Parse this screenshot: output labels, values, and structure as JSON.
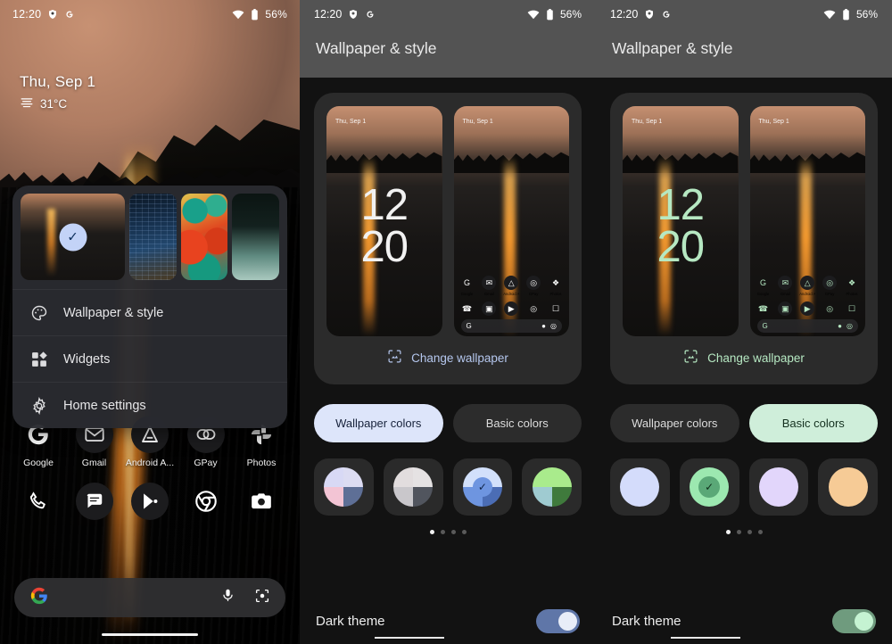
{
  "home": {
    "status_bar": {
      "time": "12:20",
      "icons_left": [
        "shield-icon",
        "google-g-icon"
      ],
      "icons_right": [
        "wifi-icon",
        "battery-icon"
      ],
      "battery": "56%"
    },
    "clock_widget": {
      "date": "Thu, Sep 1",
      "temperature": "31°C",
      "weather_icon": "haze-icon"
    },
    "popup_menu": {
      "wallpaper_thumbnails": [
        {
          "name": "yosemite-firefall-wallpaper",
          "selected": true
        },
        {
          "name": "city-night-wallpaper",
          "selected": false
        },
        {
          "name": "abstract-art-wallpaper",
          "selected": false
        },
        {
          "name": "gradient-wallpaper",
          "selected": false
        }
      ],
      "items": [
        {
          "label": "Wallpaper & style",
          "icon": "palette-icon"
        },
        {
          "label": "Widgets",
          "icon": "widgets-icon"
        },
        {
          "label": "Home settings",
          "icon": "gear-icon"
        }
      ]
    },
    "apps_row1": [
      {
        "label": "Google",
        "icon": "google-g-icon"
      },
      {
        "label": "Gmail",
        "icon": "gmail-icon"
      },
      {
        "label": "Android A...",
        "icon": "android-auto-icon"
      },
      {
        "label": "GPay",
        "icon": "gpay-icon"
      },
      {
        "label": "Photos",
        "icon": "photos-icon"
      }
    ],
    "apps_row2": [
      {
        "label": "",
        "icon": "phone-icon"
      },
      {
        "label": "",
        "icon": "messages-icon"
      },
      {
        "label": "",
        "icon": "play-store-icon"
      },
      {
        "label": "",
        "icon": "chrome-icon"
      },
      {
        "label": "",
        "icon": "camera-icon"
      }
    ],
    "search_bar": {
      "leading_icon": "google-g-icon",
      "mic_icon": "mic-icon",
      "lens_icon": "lens-icon"
    },
    "nav_pill": "home-gesture-pill"
  },
  "settings_middle": {
    "status_bar": {
      "time": "12:20",
      "battery": "56%"
    },
    "title": "Wallpaper & style",
    "preview": {
      "lock_screen": {
        "date": "Thu, Sep 1",
        "clock_hour": "12",
        "clock_minute": "20"
      },
      "home_screen": {
        "date": "Thu, Sep 1",
        "apps_row1": [
          {
            "label": "Google",
            "icon": "google-g-icon"
          },
          {
            "label": "Gmail",
            "icon": "gmail-icon"
          },
          {
            "label": "Android A...",
            "icon": "android-auto-icon"
          },
          {
            "label": "GPay",
            "icon": "gpay-icon"
          },
          {
            "label": "Photos",
            "icon": "photos-icon"
          }
        ],
        "apps_row2": [
          {
            "icon": "phone-icon"
          },
          {
            "icon": "messages-icon"
          },
          {
            "icon": "play-store-icon"
          },
          {
            "icon": "chrome-icon"
          },
          {
            "icon": "camera-icon"
          }
        ]
      }
    },
    "change_wallpaper": {
      "label": "Change wallpaper",
      "icon": "image-frame-icon"
    },
    "tabs": [
      {
        "label": "Wallpaper colors",
        "selected": true
      },
      {
        "label": "Basic colors",
        "selected": false
      }
    ],
    "swatches": [
      {
        "name": "swatch-pink-blue",
        "selected": false,
        "colors": [
          "#d8d9f5",
          "#dcdcf2",
          "#f3c4d4",
          "#5e6f96"
        ]
      },
      {
        "name": "swatch-neutral-gray",
        "selected": false,
        "colors": [
          "#e2ddde",
          "#e5e2e3",
          "#c9c7cb",
          "#51555e"
        ]
      },
      {
        "name": "swatch-blue",
        "selected": true,
        "colors": [
          "#d2e0fb",
          "#d2e0fb",
          "#6e95e0",
          "#4b6db5"
        ]
      },
      {
        "name": "swatch-green",
        "selected": false,
        "colors": [
          "#a9eb8c",
          "#a9eb8c",
          "#9fcbd1",
          "#3f7a3c"
        ]
      }
    ],
    "page_dots": {
      "count": 4,
      "active": 0
    },
    "dark_theme": {
      "label": "Dark theme",
      "enabled": true
    },
    "accent_color": "#b5c7ee"
  },
  "settings_right": {
    "status_bar": {
      "time": "12:20",
      "battery": "56%"
    },
    "title": "Wallpaper & style",
    "preview": {
      "lock_screen": {
        "date": "Thu, Sep 1",
        "clock_hour": "12",
        "clock_minute": "20"
      },
      "home_screen": {
        "date": "Thu, Sep 1",
        "apps_row1": [
          {
            "label": "Google",
            "icon": "google-g-icon"
          },
          {
            "label": "Gmail",
            "icon": "gmail-icon"
          },
          {
            "label": "Android A...",
            "icon": "android-auto-icon"
          },
          {
            "label": "GPay",
            "icon": "gpay-icon"
          },
          {
            "label": "Photos",
            "icon": "photos-icon"
          }
        ],
        "apps_row2": [
          {
            "icon": "phone-icon"
          },
          {
            "icon": "messages-icon"
          },
          {
            "icon": "play-store-icon"
          },
          {
            "icon": "chrome-icon"
          },
          {
            "icon": "camera-icon"
          }
        ]
      }
    },
    "change_wallpaper": {
      "label": "Change wallpaper",
      "icon": "image-frame-icon"
    },
    "tabs": [
      {
        "label": "Wallpaper colors",
        "selected": false
      },
      {
        "label": "Basic colors",
        "selected": true
      }
    ],
    "swatches": [
      {
        "name": "swatch-basic-blue",
        "selected": false,
        "color": "#d4dcfb"
      },
      {
        "name": "swatch-basic-green",
        "selected": true,
        "color": "#9ce8b0"
      },
      {
        "name": "swatch-basic-purple",
        "selected": false,
        "color": "#e2d6fb"
      },
      {
        "name": "swatch-basic-orange",
        "selected": false,
        "color": "#f6cb96"
      }
    ],
    "page_dots": {
      "count": 4,
      "active": 0
    },
    "dark_theme": {
      "label": "Dark theme",
      "enabled": true
    },
    "accent_color": "#b6e8c2"
  }
}
